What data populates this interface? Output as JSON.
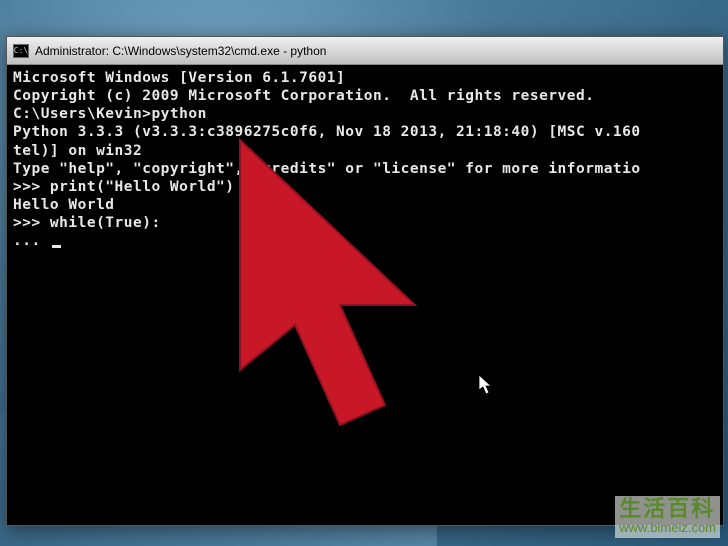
{
  "window": {
    "icon_label": "C:\\",
    "title": "Administrator: C:\\Windows\\system32\\cmd.exe - python"
  },
  "terminal": {
    "lines": [
      "Microsoft Windows [Version 6.1.7601]",
      "Copyright (c) 2009 Microsoft Corporation.  All rights reserved.",
      "",
      "C:\\Users\\Kevin>python",
      "Python 3.3.3 (v3.3.3:c3896275c0f6, Nov 18 2013, 21:18:40) [MSC v.160",
      "tel)] on win32",
      "Type \"help\", \"copyright\", \"credits\" or \"license\" for more informatio",
      ">>> print(\"Hello World\")",
      "Hello World",
      ">>> while(True):",
      "... "
    ]
  },
  "watermark": {
    "text": "生活百科",
    "url": "www.bimeiz.com"
  },
  "overlay": {
    "arrow": "large-red-arrow-cursor",
    "cursor": "white-arrow-cursor"
  }
}
